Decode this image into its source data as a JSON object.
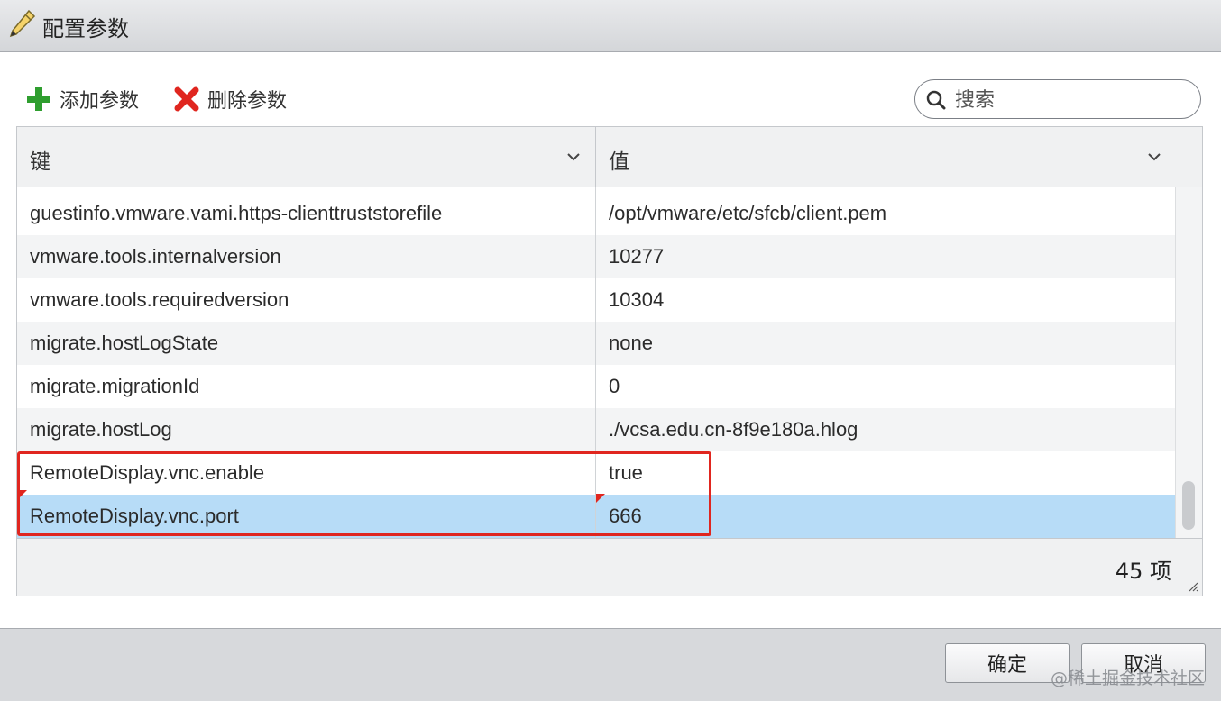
{
  "dialog": {
    "title": "配置参数"
  },
  "toolbar": {
    "add_label": "添加参数",
    "delete_label": "删除参数"
  },
  "search": {
    "placeholder": "搜索",
    "value": ""
  },
  "grid": {
    "columns": [
      {
        "label": "键"
      },
      {
        "label": "值"
      }
    ],
    "rows": [
      {
        "key": "guestinfo.vmware.vami.https-clienttruststorefile",
        "value": "/opt/vmware/etc/sfcb/client.pem"
      },
      {
        "key": "vmware.tools.internalversion",
        "value": "10277"
      },
      {
        "key": "vmware.tools.requiredversion",
        "value": "10304"
      },
      {
        "key": "migrate.hostLogState",
        "value": "none"
      },
      {
        "key": "migrate.migrationId",
        "value": "0"
      },
      {
        "key": "migrate.hostLog",
        "value": "./vcsa.edu.cn-8f9e180a.hlog"
      },
      {
        "key": "RemoteDisplay.vnc.enable",
        "value": "true"
      },
      {
        "key": "RemoteDisplay.vnc.port",
        "value": "666",
        "selected": true
      }
    ],
    "item_count": "45 项"
  },
  "buttons": {
    "ok": "确定",
    "cancel": "取消"
  },
  "watermark": "@稀土掘金技术社区",
  "colors": {
    "highlight_border": "#e0261f",
    "selected_row": "#b7dcf7",
    "add_icon": "#2f9e2f",
    "delete_icon": "#e0261f"
  },
  "icons": {
    "title": "pencil-icon",
    "add": "plus-icon",
    "delete": "x-icon",
    "search": "search-icon",
    "sort": "chevron-down-icon"
  }
}
